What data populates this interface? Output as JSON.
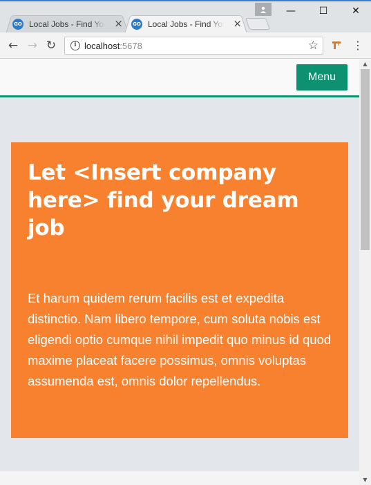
{
  "browser": {
    "tabs": [
      {
        "title": "Local Jobs - Find Your Dream Job",
        "favicon": "GO",
        "active": false
      },
      {
        "title": "Local Jobs - Find Your Dream Job",
        "favicon": "GO",
        "active": true
      }
    ],
    "tab_close_glyph": "×",
    "window_controls": {
      "minimize": "—",
      "maximize": "☐",
      "close": "✕"
    },
    "nav": {
      "back": "←",
      "forward": "→",
      "reload": "↻"
    },
    "address": {
      "host": "localhost",
      "port": ":5678"
    },
    "icons": [
      "back-arrow-icon",
      "forward-arrow-icon",
      "reload-icon",
      "info-icon",
      "star-icon",
      "extension-icon",
      "menu-kebab-icon",
      "profile-icon"
    ]
  },
  "site": {
    "menu_button_label": "Menu",
    "hero": {
      "heading": "Let <Insert company here> find your dream job",
      "body": "Et harum quidem rerum facilis est et expedita distinctio. Nam libero tempore, cum soluta nobis est eligendi optio cumque nihil impedit quo minus id quod maxime placeat facere possimus, omnis voluptas assumenda est, omnis dolor repellendus."
    }
  },
  "colors": {
    "accent_green": "#0e9170",
    "hero_orange": "#f8812f",
    "page_background": "#e3e7eb"
  }
}
